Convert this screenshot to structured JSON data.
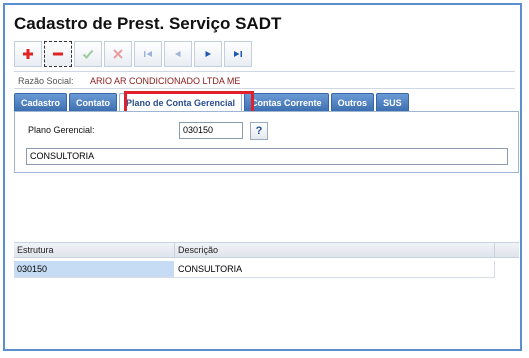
{
  "window": {
    "title": "Cadastro de Prest. Serviço SADT"
  },
  "toolbar": {
    "buttons": [
      {
        "name": "add",
        "icon": "plus-icon",
        "color": "#e02424"
      },
      {
        "name": "remove",
        "icon": "minus-icon",
        "color": "#e02424"
      },
      {
        "name": "confirm",
        "icon": "check-icon",
        "color": "#9ccc9c"
      },
      {
        "name": "cancel",
        "icon": "x-icon",
        "color": "#e8a0a0"
      },
      {
        "name": "first",
        "icon": "first-record-icon",
        "color": "#9db3d6"
      },
      {
        "name": "previous",
        "icon": "previous-record-icon",
        "color": "#9db3d6"
      },
      {
        "name": "next",
        "icon": "next-record-icon",
        "color": "#1f56b8"
      },
      {
        "name": "last",
        "icon": "last-record-icon",
        "color": "#1f56b8"
      }
    ]
  },
  "razao_social": {
    "label": "Razão Social:",
    "value": "ARIO AR CONDICIONADO LTDA ME"
  },
  "tabs": [
    {
      "label": "Cadastro",
      "active": false
    },
    {
      "label": "Contato",
      "active": false
    },
    {
      "label": "Plano de Conta Gerencial",
      "active": true
    },
    {
      "label": "Contas Corrente",
      "active": false
    },
    {
      "label": "Outros",
      "active": false
    },
    {
      "label": "SUS",
      "active": false
    }
  ],
  "form": {
    "plano_label": "Plano Gerencial:",
    "plano_value": "030150",
    "help_label": "?",
    "descricao_value": "CONSULTORIA"
  },
  "grid": {
    "columns": [
      "Estrutura",
      "Descrição"
    ],
    "rows": [
      {
        "estrutura": "030150",
        "descricao": "CONSULTORIA"
      }
    ]
  },
  "colors": {
    "highlight": "#e0202a",
    "tab": "#3d6fb0",
    "razao_value": "#8b1a1a"
  }
}
